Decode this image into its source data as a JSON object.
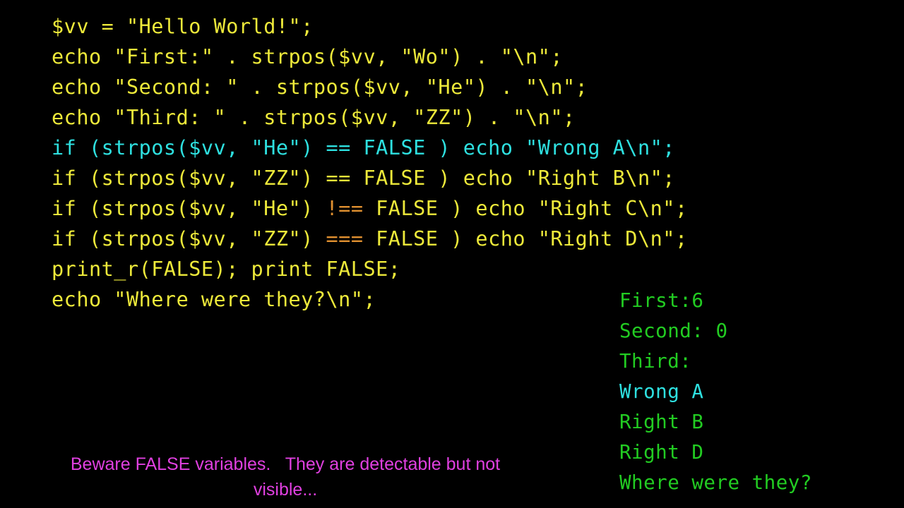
{
  "slide": {
    "background_color": "#000000",
    "title": "Beware FALSE variables"
  },
  "palette": {
    "code_yellow": "#ede93a",
    "code_cyan": "#2ee0e0",
    "operator_orange": "#e09030",
    "output_green": "#22cc22",
    "output_cyan": "#2ee0e0",
    "caption_magenta": "#e040e0",
    "background": "#000000"
  },
  "code": {
    "language": "php",
    "lines": [
      {
        "id": "line-1",
        "color": "yellow",
        "text": "$vv = \"Hello World!\";"
      },
      {
        "id": "line-2",
        "color": "yellow",
        "text": "echo \"First:\" . strpos($vv, \"Wo\") . \"\\n\";"
      },
      {
        "id": "line-3",
        "color": "yellow",
        "text": "echo \"Second: \" . strpos($vv, \"He\") . \"\\n\";"
      },
      {
        "id": "line-4",
        "color": "yellow",
        "text": "echo \"Third: \" . strpos($vv, \"ZZ\") . \"\\n\";"
      },
      {
        "id": "line-5",
        "color": "cyan",
        "pre": "if (strpos($vv, \"He\") ",
        "operator": "==",
        "operator_color": "cyan",
        "post": " FALSE ) echo \"Wrong A\\n\";"
      },
      {
        "id": "line-6",
        "color": "yellow",
        "pre": "if (strpos($vv, \"ZZ\") ",
        "operator": "==",
        "operator_color": "yellow",
        "post": " FALSE ) echo \"Right B\\n\";"
      },
      {
        "id": "line-7",
        "color": "yellow",
        "pre": "if (strpos($vv, \"He\") ",
        "operator": "!==",
        "operator_color": "orange",
        "post": " FALSE ) echo \"Right C\\n\";"
      },
      {
        "id": "line-8",
        "color": "yellow",
        "pre": "if (strpos($vv, \"ZZ\") ",
        "operator": "===",
        "operator_color": "orange",
        "post": " FALSE ) echo \"Right D\\n\";"
      },
      {
        "id": "line-9",
        "color": "yellow",
        "text": "print_r(FALSE); print FALSE;"
      },
      {
        "id": "line-10",
        "color": "yellow",
        "text": "echo \"Where were they?\\n\";"
      }
    ]
  },
  "output": {
    "lines": [
      {
        "id": "out-1",
        "color": "green",
        "text": "First:6"
      },
      {
        "id": "out-2",
        "color": "green",
        "text": "Second: 0"
      },
      {
        "id": "out-3",
        "color": "green",
        "text": "Third:"
      },
      {
        "id": "out-4",
        "color": "cyan",
        "text": "Wrong A"
      },
      {
        "id": "out-5",
        "color": "green",
        "text": "Right B"
      },
      {
        "id": "out-6",
        "color": "green",
        "text": "Right D"
      },
      {
        "id": "out-7",
        "color": "green",
        "text": "Where were they?"
      }
    ]
  },
  "caption": {
    "line1": "Beware FALSE variables.   They are detectable but not",
    "line2": "visible..."
  }
}
